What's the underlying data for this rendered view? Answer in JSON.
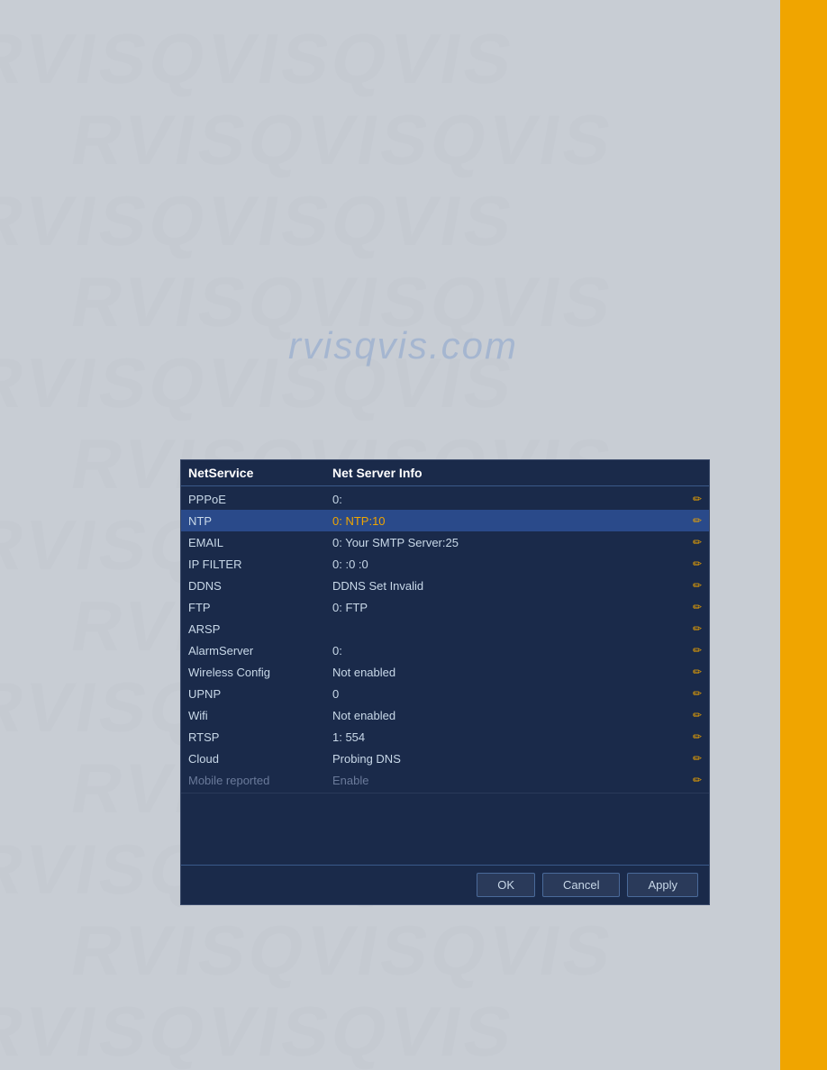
{
  "background": {
    "color": "#c8cdd4",
    "watermark_text": "RVISQVIS"
  },
  "sidebar": {
    "color": "#f0a500"
  },
  "dialog": {
    "header": {
      "col1": "NetService",
      "col2": "Net Server Info"
    },
    "rows": [
      {
        "name": "PPPoE",
        "value": "0:",
        "highlight": false,
        "dimmed": false,
        "value_color": "normal"
      },
      {
        "name": "NTP",
        "value": "0: NTP:10",
        "highlight": true,
        "dimmed": false,
        "value_color": "orange"
      },
      {
        "name": "EMAIL",
        "value": "0: Your SMTP Server:25",
        "highlight": false,
        "dimmed": false,
        "value_color": "normal"
      },
      {
        "name": "IP FILTER",
        "value": "0: :0 :0",
        "highlight": false,
        "dimmed": false,
        "value_color": "normal"
      },
      {
        "name": "DDNS",
        "value": "DDNS Set Invalid",
        "highlight": false,
        "dimmed": false,
        "value_color": "normal"
      },
      {
        "name": "FTP",
        "value": "0: FTP",
        "highlight": false,
        "dimmed": false,
        "value_color": "normal"
      },
      {
        "name": "ARSP",
        "value": "",
        "highlight": false,
        "dimmed": false,
        "value_color": "normal"
      },
      {
        "name": "AlarmServer",
        "value": "0:",
        "highlight": false,
        "dimmed": false,
        "value_color": "normal"
      },
      {
        "name": "Wireless Config",
        "value": "Not enabled",
        "highlight": false,
        "dimmed": false,
        "value_color": "normal"
      },
      {
        "name": "UPNP",
        "value": "0",
        "highlight": false,
        "dimmed": false,
        "value_color": "normal"
      },
      {
        "name": "Wifi",
        "value": "Not enabled",
        "highlight": false,
        "dimmed": false,
        "value_color": "normal"
      },
      {
        "name": "RTSP",
        "value": "1: 554",
        "highlight": false,
        "dimmed": false,
        "value_color": "normal"
      },
      {
        "name": "Cloud",
        "value": "Probing DNS",
        "highlight": false,
        "dimmed": false,
        "value_color": "normal"
      },
      {
        "name": "Mobile reported",
        "value": "Enable",
        "highlight": false,
        "dimmed": true,
        "value_color": "normal"
      }
    ],
    "footer": {
      "ok_label": "OK",
      "cancel_label": "Cancel",
      "apply_label": "Apply"
    }
  }
}
